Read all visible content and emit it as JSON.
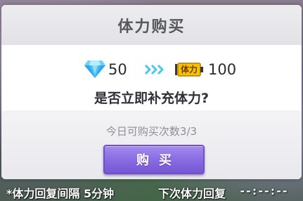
{
  "dialog": {
    "title": "体力购买",
    "cost": {
      "icon": "diamond-icon",
      "value": "50"
    },
    "arrow_icon": "triple-chevron-right-icon",
    "gain": {
      "icon_label": "体力",
      "value": "100"
    },
    "prompt": "是否立即补充体力?",
    "daily_count": "今日可购买次数3/3",
    "buy_button_label": "购买"
  },
  "status_bar": {
    "interval_text": "*体力回复间隔 5分钟",
    "next_recover_label": "下次体力回复",
    "next_recover_timer": "--:--:--"
  },
  "colors": {
    "button_primary": "#8a6fe3",
    "diamond": "#2aa8ef",
    "stamina_icon": "#f5c400",
    "arrows": "#46c8e8"
  }
}
